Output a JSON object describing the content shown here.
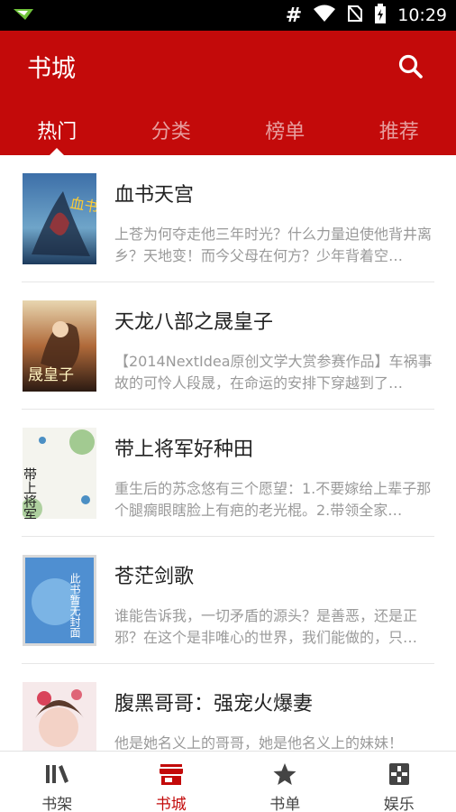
{
  "status_bar": {
    "time": "10:29",
    "signal_char": "#",
    "icons": [
      "notification-icon",
      "wifi-icon",
      "no-sim-icon",
      "battery-charging-icon"
    ]
  },
  "header": {
    "title": "书城",
    "search_icon": "search-icon"
  },
  "tabs": [
    {
      "label": "热门",
      "active": true
    },
    {
      "label": "分类",
      "active": false
    },
    {
      "label": "榜单",
      "active": false
    },
    {
      "label": "推荐",
      "active": false
    }
  ],
  "books": [
    {
      "title": "血书天宫",
      "description": "上苍为何夺走他三年时光？什么力量迫使他背井离乡？天地变！而今父母在何方？少年背着空…",
      "cover_text": "血书天宫"
    },
    {
      "title": "天龙八部之晟皇子",
      "description": "【2014NextIdea原创文学大赏参赛作品】车祸事故的可怜人段晟，在命运的安排下穿越到了…",
      "cover_text": "晟皇子"
    },
    {
      "title": "带上将军好种田",
      "description": "重生后的苏念悠有三个愿望：1.不要嫁给上辈子那个腿瘸眼瞎脸上有疤的老光棍。2.带领全家…",
      "cover_text": "带上将军"
    },
    {
      "title": "苍茫剑歌",
      "description": "谁能告诉我，一切矛盾的源头？是善恶，还是正邪？在这个是非唯心的世界，我们能做的，只…",
      "cover_text": "此书暂无封面"
    },
    {
      "title": "腹黑哥哥：强宠火爆妻",
      "description": "他是她名义上的哥哥，她是他名义上的妹妹！",
      "cover_text": ""
    }
  ],
  "bottom_nav": [
    {
      "label": "书架",
      "icon": "bookshelf-icon",
      "active": false
    },
    {
      "label": "书城",
      "icon": "store-icon",
      "active": true
    },
    {
      "label": "书单",
      "icon": "star-icon",
      "active": false
    },
    {
      "label": "娱乐",
      "icon": "game-icon",
      "active": false
    }
  ],
  "colors": {
    "primary": "#c30a0a",
    "text_dark": "#222222",
    "text_muted": "#9a9a9a"
  }
}
